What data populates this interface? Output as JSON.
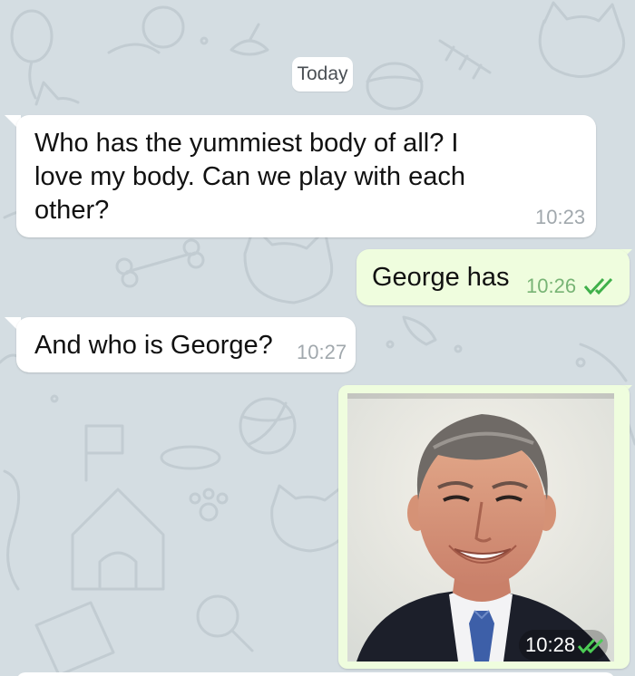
{
  "chat": {
    "date_label": "Today",
    "messages": [
      {
        "direction": "incoming",
        "text": "Who has the yummiest body of all? I\nlove my body. Can we play with each\nother?",
        "time": "10:23"
      },
      {
        "direction": "outgoing",
        "text": "George has",
        "time": "10:26",
        "status_icon": "double-check-icon"
      },
      {
        "direction": "incoming",
        "text": "And who is George?",
        "time": "10:27"
      },
      {
        "direction": "outgoing",
        "type": "photo",
        "photo_subject": "portrait of a smiling man in a dark suit and blue tie",
        "time": "10:28",
        "status_icon": "double-check-icon"
      }
    ]
  },
  "colors": {
    "wallpaper": "#d4dde2",
    "incoming_bubble": "#ffffff",
    "outgoing_bubble": "#effdde",
    "outgoing_time": "#78b475",
    "incoming_time": "#a1a8ad",
    "check": "#3fb04a"
  }
}
